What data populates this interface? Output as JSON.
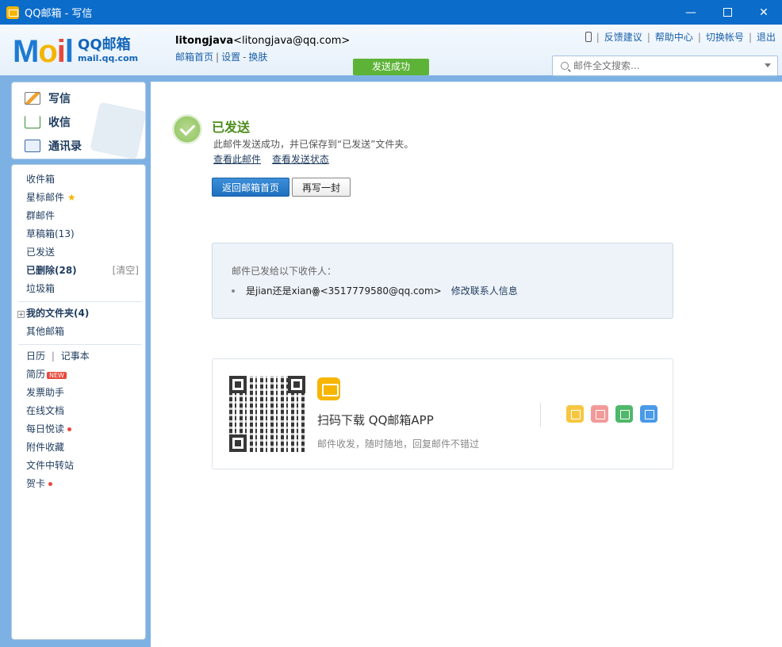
{
  "window": {
    "title": "QQ邮箱 - 写信",
    "min": "—",
    "close": "✕"
  },
  "logo": {
    "m": "M",
    "o": "o",
    "i": "i",
    "l": "l",
    "brand": "QQ邮箱",
    "domain": "mail.qq.com"
  },
  "user": {
    "name": "litongjava",
    "email": "<litongjava@qq.com>",
    "links": [
      "邮箱首页",
      "设置",
      "换肤"
    ],
    "sep1": "|",
    "sep2": "-"
  },
  "status": {
    "send_success": "发送成功"
  },
  "toplinks": {
    "feedback": "反馈建议",
    "help": "帮助中心",
    "switch": "切换帐号",
    "logout": "退出",
    "sep": "|"
  },
  "search": {
    "placeholder": "邮件全文搜索..."
  },
  "quick": {
    "write": "写信",
    "receive": "收信",
    "contacts": "通讯录"
  },
  "folders": {
    "inbox": "收件箱",
    "starred": "星标邮件",
    "star_glyph": "★",
    "group": "群邮件",
    "drafts": "草稿箱(13)",
    "sent": "已发送",
    "deleted": "已删除(28)",
    "clear": "[清空]",
    "spam": "垃圾箱",
    "myfolders_toggle": "+",
    "myfolders": "我的文件夹(4)",
    "other": "其他邮箱",
    "calendar": "日历",
    "cal_sep": "|",
    "notes": "记事本",
    "resume": "简历",
    "new_badge": "NEW",
    "invoice": "发票助手",
    "docs": "在线文档",
    "daily": "每日悦读",
    "attachments": "附件收藏",
    "transfer": "文件中转站",
    "cards": "贺卡"
  },
  "result": {
    "title": "已发送",
    "desc": "此邮件发送成功，并已保存到“已发送”文件夹。",
    "view_mail": "查看此邮件",
    "view_status": "查看发送状态",
    "back_btn": "返回邮箱首页",
    "again_btn": "再写一封"
  },
  "recipients": {
    "title": "邮件已发给以下收件人：",
    "items": [
      {
        "name": "是jian还是xian",
        "icon": "ꙮ",
        "email": "<3517779580@qq.com>",
        "action": "修改联系人信息"
      }
    ]
  },
  "app_promo": {
    "title": "扫码下载 QQ邮箱APP",
    "subtitle": "邮件收发，随时随地，回复邮件不错过"
  },
  "colors": {
    "titlebar": "#0b6cc9",
    "accent": "#1e6fbe",
    "success": "#5db338",
    "frame": "#7eb1e3"
  }
}
